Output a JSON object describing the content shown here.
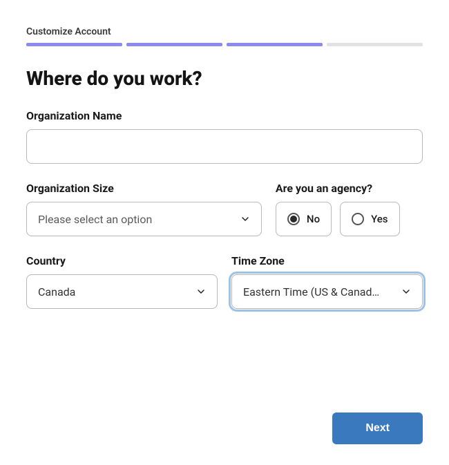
{
  "step_label": "Customize Account",
  "progress": {
    "filled": 3,
    "total": 4
  },
  "heading": "Where do you work?",
  "fields": {
    "org_name": {
      "label": "Organization Name",
      "value": ""
    },
    "org_size": {
      "label": "Organization Size",
      "placeholder": "Please select an option"
    },
    "agency": {
      "label": "Are you an agency?",
      "options": {
        "no": "No",
        "yes": "Yes"
      },
      "selected": "no"
    },
    "country": {
      "label": "Country",
      "value": "Canada"
    },
    "timezone": {
      "label": "Time Zone",
      "value": "Eastern Time (US & Canad…"
    }
  },
  "actions": {
    "next": "Next"
  },
  "colors": {
    "accent": "#8b8bef",
    "primary_button": "#3b79bf",
    "focus_ring": "#9ec1e8"
  }
}
